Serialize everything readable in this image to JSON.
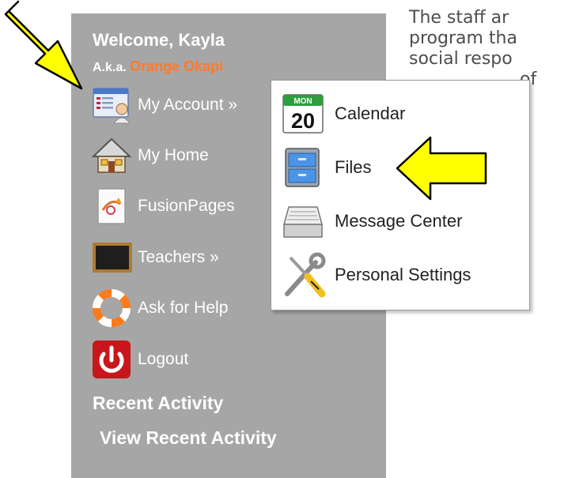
{
  "article": {
    "lines": [
      "The staff ar",
      "program tha",
      "social respo",
      "of"
    ]
  },
  "sidebar": {
    "welcome": "Welcome, Kayla",
    "aka_label": "A.k.a.",
    "aka_name": "Orange Okapi",
    "items": [
      {
        "label": "My Account »",
        "icon": "account-card-icon"
      },
      {
        "label": "My Home",
        "icon": "house-icon"
      },
      {
        "label": "FusionPages",
        "icon": "fusionpages-icon"
      },
      {
        "label": "Teachers »",
        "icon": "chalkboard-icon"
      },
      {
        "label": "Ask for Help",
        "icon": "life-ring-icon"
      },
      {
        "label": "Logout",
        "icon": "power-icon"
      }
    ],
    "recent_heading": "Recent Activity",
    "recent_link": "View Recent Activity"
  },
  "dropdown": {
    "items": [
      {
        "label": "Calendar",
        "icon": "calendar-icon",
        "calendar_day": "MON",
        "calendar_date": "20"
      },
      {
        "label": "Files",
        "icon": "file-cabinet-icon"
      },
      {
        "label": "Message Center",
        "icon": "inbox-tray-icon"
      },
      {
        "label": "Personal Settings",
        "icon": "wrench-screwdriver-icon"
      }
    ]
  },
  "colors": {
    "sidebar_bg": "#a6a6a6",
    "nickname": "#ff7a2a",
    "arrow_fill": "#ffff00"
  }
}
